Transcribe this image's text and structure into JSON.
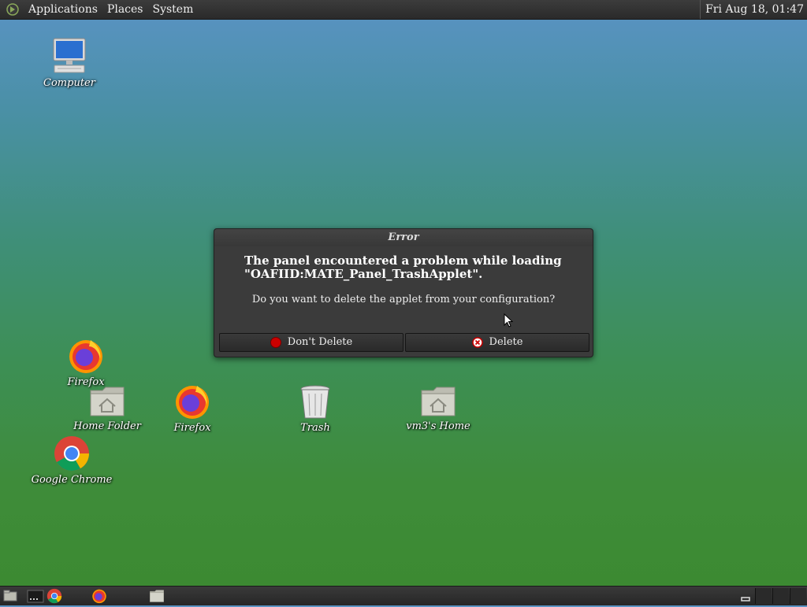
{
  "top_panel": {
    "menus": [
      "Applications",
      "Places",
      "System"
    ],
    "clock": "Fri Aug 18, 01:47"
  },
  "desktop": {
    "icons": {
      "computer": "Computer",
      "firefox_1": "Firefox",
      "home_folder": "Home Folder",
      "firefox_2": "Firefox",
      "trash": "Trash",
      "user_home": "vm3's Home",
      "chrome": "Google Chrome"
    }
  },
  "dialog": {
    "title": "Error",
    "primary_line1": "The panel encountered a problem while loading",
    "primary_line2": "\"OAFIID:MATE_Panel_TrashApplet\".",
    "secondary": "Do you want to delete the applet from your configuration?",
    "buttons": {
      "dont_delete": "Don't Delete",
      "delete": "Delete"
    }
  }
}
